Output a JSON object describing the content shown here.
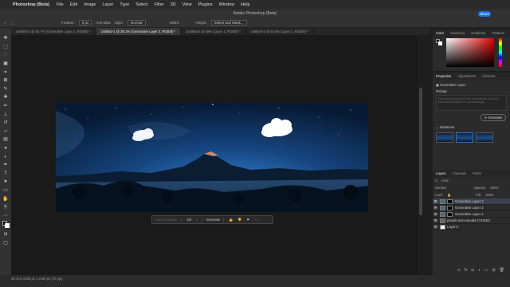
{
  "menubar": {
    "app_name": "Photoshop (Beta)",
    "items": [
      "File",
      "Edit",
      "Image",
      "Layer",
      "Type",
      "Select",
      "Filter",
      "3D",
      "View",
      "Plugins",
      "Window",
      "Help"
    ]
  },
  "window": {
    "title": "Adobe Photoshop (Beta)",
    "share_label": "Share"
  },
  "options": {
    "feather_label": "Feather:",
    "feather_value": "0 px",
    "antialias_label": "Anti-alias",
    "style_label": "Style:",
    "style_value": "Normal",
    "width_label": "Width:",
    "height_label": "Height:",
    "select_mask_label": "Select and Mask..."
  },
  "tabs": [
    {
      "label": "Untitled-2 @ 66.7% (Generative Layer 2, RGB/8) *"
    },
    {
      "label": "Untitled-1 @ 38.1% (Generative Layer 3, RGB/8) *"
    },
    {
      "label": "Untitled-3 @ 59% (Layer 1, RGB/8) *"
    },
    {
      "label": "Untitled-4 @ 53.6% (Layer 1, RGB/8) *"
    }
  ],
  "contextbar": {
    "prompt_placeholder": "Add a prompt...",
    "counter": "3/3",
    "generate_label": "Generate"
  },
  "status": {
    "text": "38.11%      6336 px x 2160 px (72 ppi)"
  },
  "color_panel": {
    "tabs": [
      "Color",
      "Swatches",
      "Gradients",
      "Patterns"
    ]
  },
  "properties": {
    "tabs": [
      "Properties",
      "Adjustments",
      "Libraries"
    ],
    "layer_type": "Generative Layer",
    "prompt_label": "Prompt",
    "prompt_placeholder": "Describe what you'd like to generate or leave blank to fill based on surroundings",
    "generate_label": "Generate",
    "variations_label": "Variations"
  },
  "layers": {
    "tabs": [
      "Layers",
      "Channels",
      "Paths"
    ],
    "kind_label": "Kind",
    "blend_mode": "Normal",
    "opacity_label": "Opacity:",
    "opacity_value": "100%",
    "lock_label": "Lock:",
    "fill_label": "Fill:",
    "fill_value": "100%",
    "rows": [
      {
        "name": "Generative Layer 3"
      },
      {
        "name": "Generative Layer 2"
      },
      {
        "name": "Generative Layer 1"
      },
      {
        "name": "pexels-aron-visuals-1743183"
      },
      {
        "name": "Layer 0"
      }
    ]
  }
}
